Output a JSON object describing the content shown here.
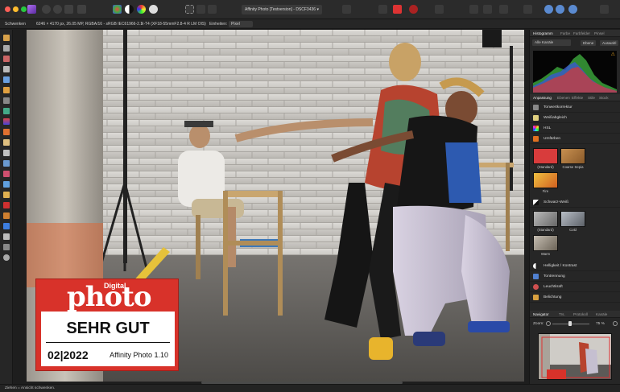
{
  "app": {
    "document_title": "Affinity Photo [Testversion] - DSCF3436 ▾"
  },
  "context_bar": {
    "tool_name": "Schwenken",
    "image_info": "6246 × 4170 px, 26.05 MP, RGBA/16 - sRGB IEC61966-2.1",
    "camera_info": "X-T4 (XF18-55mmF2.8-4 R LM OIS)",
    "units_label": "Einheiten:",
    "units_value": "Pixel"
  },
  "badge": {
    "digital": "Digital",
    "photo": "photo",
    "rating": "SEHR GUT",
    "date": "02|2022",
    "product": "Affinity Photo 1.10"
  },
  "panels": {
    "top_tabs": [
      "Histogramm",
      "Farbe",
      "Farbfelder",
      "Pinsel"
    ],
    "histogram": {
      "channel": "Alle Kanäle",
      "options": [
        "Ebene",
        "Auswahl"
      ],
      "warning_icon": "warning-icon"
    },
    "adjust_tabs": [
      "Anpassung",
      "Ebenen",
      "Effekte",
      "Stile",
      "Stock"
    ],
    "adjustments": [
      {
        "label": "Tonwertkorrektur",
        "icon": "levels-icon",
        "color": "#888888"
      },
      {
        "label": "Weißabgleich",
        "icon": "white-balance-icon",
        "color": "#e0d080"
      },
      {
        "label": "HSL",
        "icon": "hsl-icon",
        "color": "#d04060"
      },
      {
        "label": "Umfärben",
        "icon": "recolor-icon",
        "color": "#e07020"
      }
    ],
    "presets_color": [
      {
        "label": "(Standard)",
        "color": "#d83c3c"
      },
      {
        "label": "Coarse Sepia",
        "color": "#b07a40"
      },
      {
        "label": "Fire",
        "color": "#e8a030"
      }
    ],
    "bw": {
      "label": "Schwarz-Weiß",
      "icon": "bw-icon"
    },
    "presets_bw": [
      {
        "label": "(Standard)",
        "color": "#999999"
      },
      {
        "label": "Cold",
        "color": "#8a8f95"
      },
      {
        "label": "Warm",
        "color": "#a09a90"
      }
    ],
    "adjustments_more": [
      {
        "label": "Helligkeit / Kontrast",
        "icon": "brightness-icon",
        "color": "#bbbbbb"
      },
      {
        "label": "Tontrennung",
        "icon": "posterize-icon",
        "color": "#5080d0"
      },
      {
        "label": "Leuchtkraft",
        "icon": "vibrance-icon",
        "color": "#d05050"
      },
      {
        "label": "Belichtung",
        "icon": "exposure-icon",
        "color": "#d8a040"
      }
    ],
    "bottom_tabs": [
      "Navigator",
      "Trs.",
      "Protokoll",
      "Kanäle"
    ],
    "navigator": {
      "zoom_label": "Zoom:",
      "zoom_value": "75 %"
    }
  },
  "status": {
    "text": "Ziehen = Ansicht schwenken."
  },
  "colors": {
    "accent": "#3d7ee0",
    "panel_bg": "#262626",
    "badge_red": "#d8322a"
  }
}
